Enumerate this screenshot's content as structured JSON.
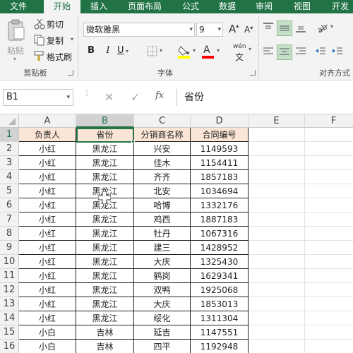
{
  "tabs": [
    "文件",
    "开始",
    "插入",
    "页面布局",
    "公式",
    "数据",
    "审阅",
    "视图",
    "开发"
  ],
  "clipboard": {
    "paste": "粘贴",
    "cut": "剪切",
    "copy": "复制",
    "format_painter": "格式刷",
    "group_label": "剪贴板"
  },
  "font": {
    "name": "微软雅黑",
    "size": "9",
    "group_label": "字体",
    "bold": "B",
    "italic": "I",
    "underline": "U",
    "grow": "A",
    "shrink": "A",
    "wen": "wén",
    "wen_sub": "文"
  },
  "alignment": {
    "group_label": "对齐方式"
  },
  "formula_bar": {
    "name_box": "B1",
    "fx": "fx",
    "value": "省份"
  },
  "colors": {
    "accent": "#217346",
    "header_fill": "#fbe5d6",
    "highlight_fill": "#ffff00",
    "font_color": "#ff0000"
  },
  "columns": [
    "A",
    "B",
    "C",
    "D",
    "E",
    "F"
  ],
  "rows": [
    {
      "num": "1",
      "cells": [
        "负责人",
        "省份",
        "分销商名称",
        "合同编号"
      ]
    },
    {
      "num": "2",
      "cells": [
        "小红",
        "黑龙江",
        "兴安",
        "1149593"
      ]
    },
    {
      "num": "3",
      "cells": [
        "小红",
        "黑龙江",
        "佳木",
        "1154411"
      ]
    },
    {
      "num": "4",
      "cells": [
        "小红",
        "黑龙江",
        "齐齐",
        "1857183"
      ]
    },
    {
      "num": "5",
      "cells": [
        "小红",
        "黑龙江",
        "北安",
        "1034694"
      ]
    },
    {
      "num": "6",
      "cells": [
        "小红",
        "黑龙江",
        "哈博",
        "1332176"
      ]
    },
    {
      "num": "7",
      "cells": [
        "小红",
        "黑龙江",
        "鸡西",
        "1887183"
      ]
    },
    {
      "num": "8",
      "cells": [
        "小红",
        "黑龙江",
        "牡丹",
        "1067316"
      ]
    },
    {
      "num": "9",
      "cells": [
        "小红",
        "黑龙江",
        "建三",
        "1428952"
      ]
    },
    {
      "num": "10",
      "cells": [
        "小红",
        "黑龙江",
        "大庆",
        "1325430"
      ]
    },
    {
      "num": "11",
      "cells": [
        "小红",
        "黑龙江",
        "鹤岗",
        "1629341"
      ]
    },
    {
      "num": "12",
      "cells": [
        "小红",
        "黑龙江",
        "双鸭",
        "1925068"
      ]
    },
    {
      "num": "13",
      "cells": [
        "小红",
        "黑龙江",
        "大庆",
        "1853013"
      ]
    },
    {
      "num": "14",
      "cells": [
        "小红",
        "黑龙江",
        "绥化",
        "1311304"
      ]
    },
    {
      "num": "15",
      "cells": [
        "小白",
        "吉林",
        "延吉",
        "1147551"
      ]
    },
    {
      "num": "16",
      "cells": [
        "小白",
        "吉林",
        "四平",
        "1192948"
      ]
    }
  ]
}
